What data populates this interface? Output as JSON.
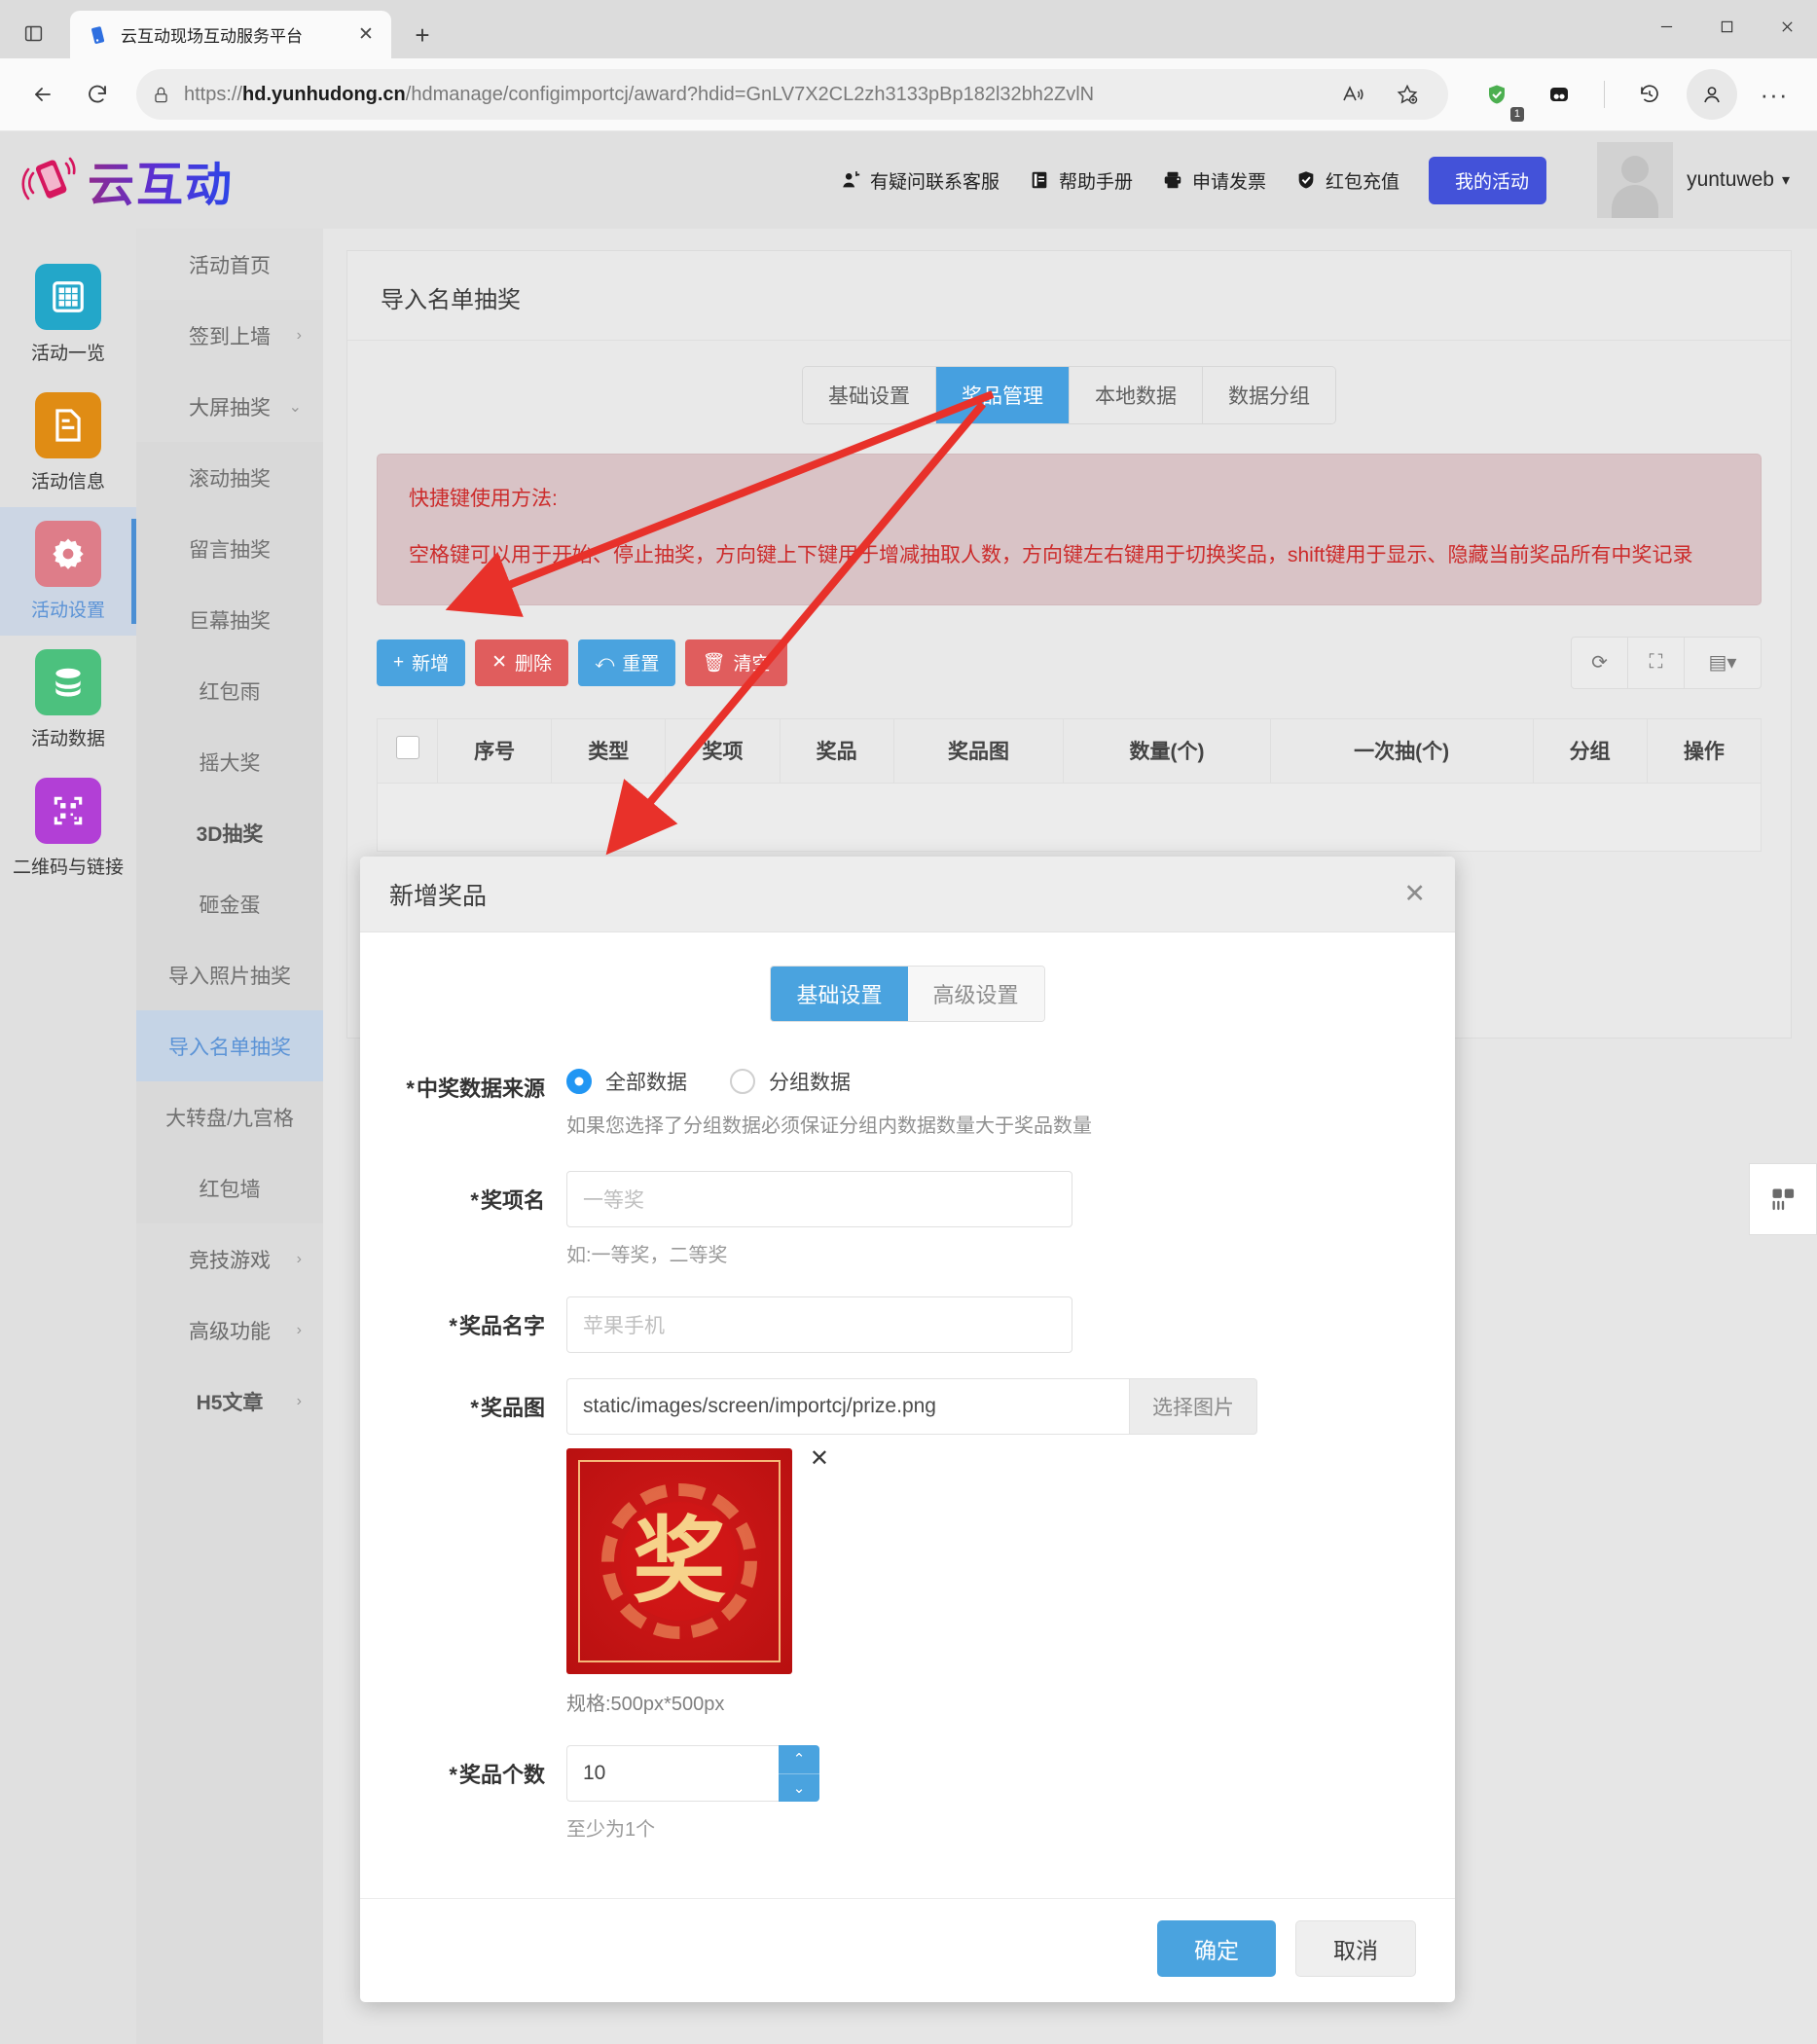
{
  "browser": {
    "tab_title": "云互动现场互动服务平台",
    "url_display": "https://hd.yunhudong.cn/hdmanage/configimportcj/award?hdid=GnLV7X2CL2zh3133pBp182l32bh2ZvlN",
    "url_host": "hd.yunhudong.cn",
    "url_scheme": "https://",
    "url_path": "/hdmanage/configimportcj/award?hdid=GnLV7X2CL2zh3133pBp182l32bh2ZvlN",
    "new_tab_label": "+",
    "close_tab_label": "✕",
    "extension_badge": "1",
    "more_label": "···"
  },
  "site_header": {
    "logo_text": "云互动",
    "nav": [
      {
        "label": "有疑问联系客服",
        "icon": "customer-service-icon"
      },
      {
        "label": "帮助手册",
        "icon": "manual-icon"
      },
      {
        "label": "申请发票",
        "icon": "invoice-icon"
      },
      {
        "label": "红包充值",
        "icon": "recharge-icon"
      }
    ],
    "primary_button": {
      "label": "我的活动",
      "icon": "list-icon"
    },
    "username": "yuntuweb",
    "user_caret": "▾"
  },
  "rail": [
    {
      "label": "活动一览",
      "icon": "grid-icon",
      "color": "#23a7c9",
      "active": false
    },
    {
      "label": "活动信息",
      "icon": "document-icon",
      "color": "#e08c14",
      "active": false
    },
    {
      "label": "活动设置",
      "icon": "gear-icon",
      "color": "#de7d89",
      "active": true
    },
    {
      "label": "活动数据",
      "icon": "database-icon",
      "color": "#4cc17e",
      "active": false
    },
    {
      "label": "二维码与链接",
      "icon": "qrcode-icon",
      "color": "#b23fd6",
      "active": false
    }
  ],
  "menu": [
    {
      "label": "活动首页",
      "type": "top",
      "caret": ""
    },
    {
      "label": "签到上墙",
      "type": "lvl0",
      "caret": "›"
    },
    {
      "label": "大屏抽奖",
      "type": "lvl0",
      "caret": "⌄"
    },
    {
      "label": "滚动抽奖",
      "type": "sub",
      "caret": ""
    },
    {
      "label": "留言抽奖",
      "type": "sub",
      "caret": ""
    },
    {
      "label": "巨幕抽奖",
      "type": "sub",
      "caret": ""
    },
    {
      "label": "红包雨",
      "type": "sub",
      "caret": ""
    },
    {
      "label": "摇大奖",
      "type": "sub",
      "caret": ""
    },
    {
      "label": "3D抽奖",
      "type": "sub",
      "caret": ""
    },
    {
      "label": "砸金蛋",
      "type": "sub",
      "caret": ""
    },
    {
      "label": "导入照片抽奖",
      "type": "sub",
      "caret": ""
    },
    {
      "label": "导入名单抽奖",
      "type": "active",
      "caret": ""
    },
    {
      "label": "大转盘/九宫格",
      "type": "sub",
      "caret": ""
    },
    {
      "label": "红包墙",
      "type": "sub",
      "caret": ""
    },
    {
      "label": "竞技游戏",
      "type": "lvl0",
      "caret": "›"
    },
    {
      "label": "高级功能",
      "type": "lvl0",
      "caret": "›"
    },
    {
      "label": "H5文章",
      "type": "lvl0",
      "caret": "›"
    }
  ],
  "main": {
    "page_title": "导入名单抽奖",
    "tabs": [
      {
        "label": "基础设置",
        "active": false
      },
      {
        "label": "奖品管理",
        "active": true
      },
      {
        "label": "本地数据",
        "active": false
      },
      {
        "label": "数据分组",
        "active": false
      }
    ],
    "notice": {
      "line1": "快捷键使用方法:",
      "line2": "空格键可以用于开始、停止抽奖，方向键上下键用于增减抽取人数，方向键左右键用于切换奖品，shift键用于显示、隐藏当前奖品所有中奖记录"
    },
    "toolbar": [
      {
        "label": "新增",
        "icon": "plus-icon",
        "style": "blue"
      },
      {
        "label": "删除",
        "icon": "cross-icon",
        "style": "red"
      },
      {
        "label": "重置",
        "icon": "reset-icon",
        "style": "blue"
      },
      {
        "label": "清空",
        "icon": "trash-icon",
        "style": "red"
      }
    ],
    "toolbar_right": [
      {
        "icon": "refresh-icon",
        "label": "⟳"
      },
      {
        "icon": "fullscreen-icon",
        "label": "⛶"
      },
      {
        "icon": "columns-icon",
        "label": "▤▾"
      }
    ],
    "table_headers": [
      "",
      "序号",
      "类型",
      "奖项",
      "奖品",
      "奖品图",
      "数量(个)",
      "一次抽(个)",
      "分组",
      "操作"
    ],
    "table_rows": []
  },
  "modal": {
    "title": "新增奖品",
    "close_label": "✕",
    "tabs": [
      {
        "label": "基础设置",
        "active": true
      },
      {
        "label": "高级设置",
        "active": false
      }
    ],
    "fields": {
      "source": {
        "label": "中奖数据来源",
        "required": "*",
        "options": [
          {
            "label": "全部数据",
            "selected": true
          },
          {
            "label": "分组数据",
            "selected": false
          }
        ],
        "hint": "如果您选择了分组数据必须保证分组内数据数量大于奖品数量"
      },
      "award_name": {
        "label": "奖项名",
        "required": "*",
        "value": "",
        "placeholder": "一等奖",
        "hint": "如:一等奖，二等奖"
      },
      "prize_name": {
        "label": "奖品名字",
        "required": "*",
        "value": "",
        "placeholder": "苹果手机"
      },
      "prize_image": {
        "label": "奖品图",
        "required": "*",
        "value": "static/images/screen/importcj/prize.png",
        "button_label": "选择图片",
        "thumb_char": "奖",
        "thumb_remove": "✕",
        "spec": "规格:500px*500px"
      },
      "prize_count": {
        "label": "奖品个数",
        "required": "*",
        "value": "10",
        "hint": "至少为1个",
        "spin_up": "⌃",
        "spin_down": "⌄"
      }
    },
    "footer": {
      "confirm": "确定",
      "cancel": "取消"
    }
  },
  "colors": {
    "accent_blue": "#4aa3df",
    "header_blue": "#4352d9",
    "danger_red": "#e05d5d",
    "notice_red": "#cc2b2b",
    "annotation_red": "#e8312a"
  }
}
